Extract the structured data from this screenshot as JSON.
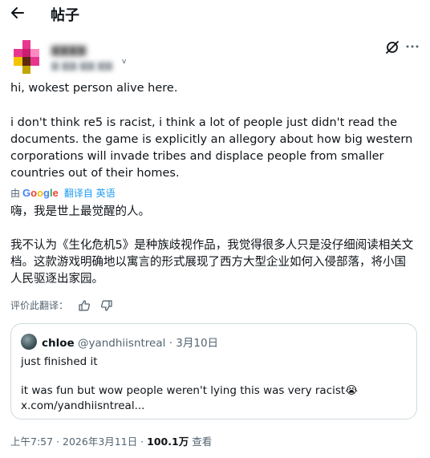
{
  "header": {
    "back_icon": "arrow-left-icon",
    "title": "帖子"
  },
  "author": {
    "name": "▆▆▆▆",
    "handle": "▆ ▆▆ ▆▆ ▆▆",
    "avatar_colors": [
      "#ffffff",
      "#e8368f",
      "#ffffff",
      "#ffffff",
      "#e8368f",
      "#c81e6f",
      "#ff8ac2",
      "#ffffff",
      "#f5c400",
      "#5a2a0f",
      "#e8368f",
      "#ffffff",
      "#ffffff",
      "#c2a400",
      "#ffffff",
      "#ffffff"
    ],
    "grok_icon": "grok-icon",
    "more_icon": "more-icon"
  },
  "post": {
    "line1": "hi, wokest person alive here.",
    "line2": "i don't think re5 is racist, i think a lot of people just didn't read the documents. the game is explicitly an allegory about how big western corporations will invade tribes and displace people from smaller countries out of their homes."
  },
  "translation": {
    "by": "由",
    "google": [
      "G",
      "o",
      "o",
      "g",
      "l",
      "e"
    ],
    "translated_from": "翻译自 英语",
    "line1": "嗨，我是世上最觉醒的人。",
    "line2": "我不认为《生化危机5》是种族歧视作品，我觉得很多人只是没仔细阅读相关文档。这款游戏明确地以寓言的形式展现了西方大型企业如何入侵部落，将小国人民驱逐出家园。",
    "rate_label": "评价此翻译："
  },
  "quote": {
    "name": "chloe",
    "handle": "@yandhiisntreal",
    "dot": "·",
    "date": "3月10日",
    "line1": "just finished it",
    "line2": "it was fun but wow people weren't lying this was very racist😭",
    "line3": "x.com/yandhiisntreal..."
  },
  "meta": {
    "time": "上午7:57",
    "dot1": "·",
    "date": "2026年3月11日",
    "dot2": "·",
    "views": "100.1万",
    "views_label": "查看"
  },
  "colors": {
    "link": "#1d9bf0",
    "secondary": "#536471",
    "border": "#cfd9de"
  }
}
